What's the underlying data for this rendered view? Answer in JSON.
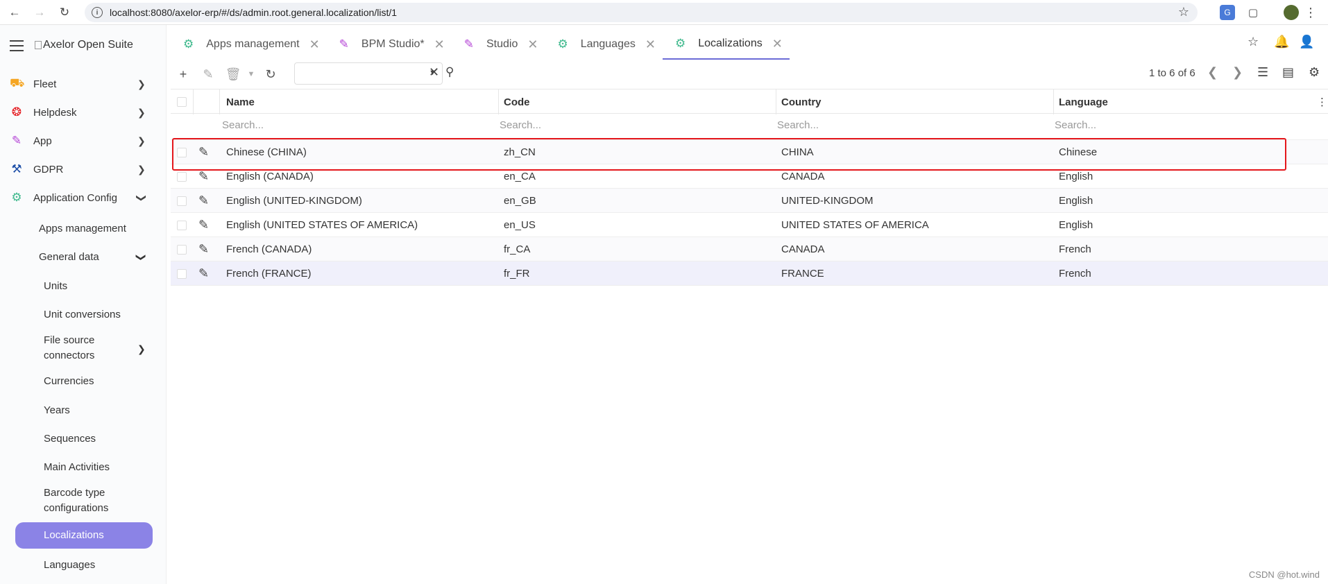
{
  "browser": {
    "url": "localhost:8080/axelor-erp/#/ds/admin.root.general.localization/list/1"
  },
  "brand": "Axelor Open Suite",
  "sidebar": {
    "items": [
      {
        "label": "Fleet",
        "icon": "car-icon",
        "color": "#f5a623"
      },
      {
        "label": "Helpdesk",
        "icon": "lifebuoy-icon",
        "color": "#e4161b"
      },
      {
        "label": "App",
        "icon": "edit-icon",
        "color": "#b545d6"
      },
      {
        "label": "GDPR",
        "icon": "hammer-icon",
        "color": "#1d4fa8"
      },
      {
        "label": "Application Config",
        "icon": "gear-icon",
        "color": "#3fb98d"
      }
    ],
    "sub": {
      "apps_management": "Apps management",
      "general_data": "General data",
      "units": "Units",
      "unit_conversions": "Unit conversions",
      "file_source_1": "File source",
      "file_source_2": "connectors",
      "currencies": "Currencies",
      "years": "Years",
      "sequences": "Sequences",
      "main_activities": "Main Activities",
      "barcode_1": "Barcode type",
      "barcode_2": "configurations",
      "localizations": "Localizations",
      "languages": "Languages"
    }
  },
  "tabs": [
    {
      "label": "Apps management"
    },
    {
      "label": "BPM Studio*"
    },
    {
      "label": "Studio"
    },
    {
      "label": "Languages"
    },
    {
      "label": "Localizations"
    }
  ],
  "toolbar": {
    "pager_text": "1 to 6 of 6"
  },
  "grid": {
    "columns": [
      "Name",
      "Code",
      "Country",
      "Language"
    ],
    "filter_placeholder": "Search...",
    "rows": [
      {
        "name": "Chinese (CHINA)",
        "code": "zh_CN",
        "country": "CHINA",
        "language": "Chinese"
      },
      {
        "name": "English (CANADA)",
        "code": "en_CA",
        "country": "CANADA",
        "language": "English"
      },
      {
        "name": "English (UNITED-KINGDOM)",
        "code": "en_GB",
        "country": "UNITED-KINGDOM",
        "language": "English"
      },
      {
        "name": "English (UNITED STATES OF AMERICA)",
        "code": "en_US",
        "country": "UNITED STATES OF AMERICA",
        "language": "English"
      },
      {
        "name": "French (CANADA)",
        "code": "fr_CA",
        "country": "CANADA",
        "language": "French"
      },
      {
        "name": "French (FRANCE)",
        "code": "fr_FR",
        "country": "FRANCE",
        "language": "French"
      }
    ]
  },
  "watermark": "CSDN @hot.wind",
  "colors": {
    "accent": "#8b83e6",
    "highlight": "#e4161b"
  }
}
